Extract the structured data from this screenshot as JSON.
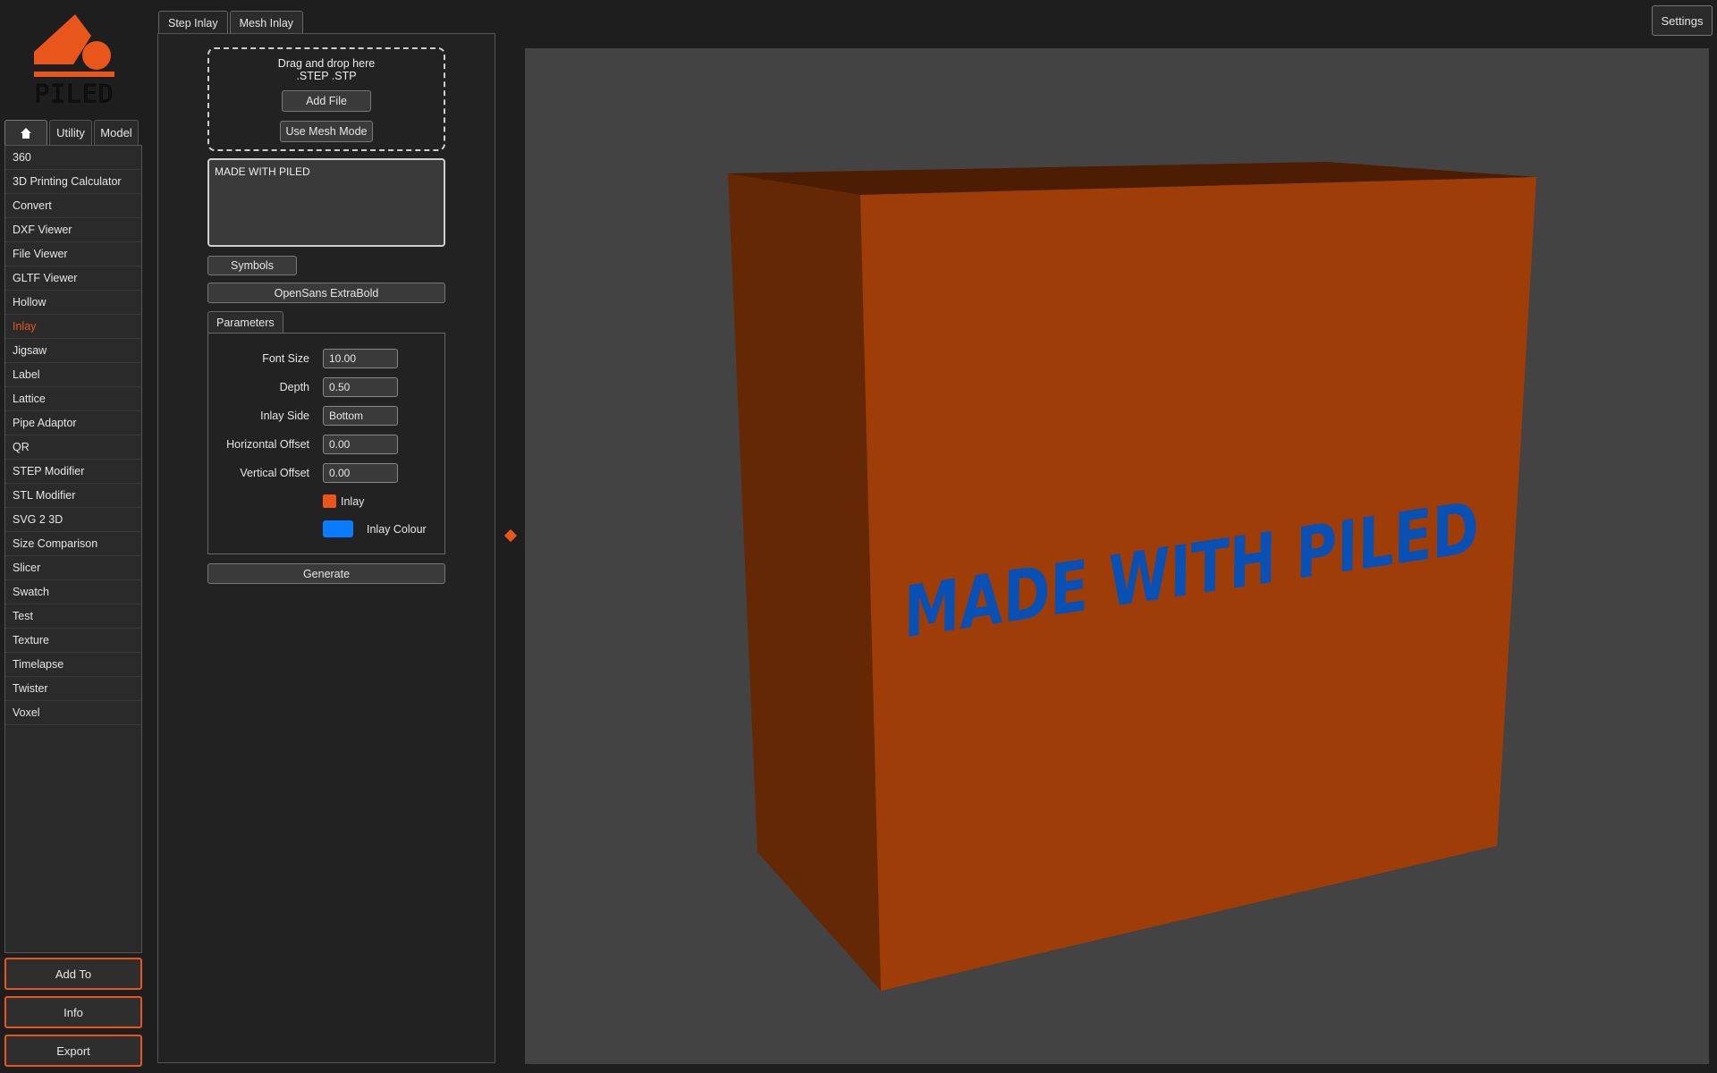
{
  "logo": {
    "text": "PILED"
  },
  "left_tabs": [
    {
      "label": "",
      "icon": "home-icon"
    },
    {
      "label": "Utility"
    },
    {
      "label": "Model"
    }
  ],
  "tools": [
    "360",
    "3D Printing Calculator",
    "Convert",
    "DXF Viewer",
    "File Viewer",
    "GLTF Viewer",
    "Hollow",
    "Inlay",
    "Jigsaw",
    "Label",
    "Lattice",
    "Pipe Adaptor",
    "QR",
    "STEP Modifier",
    "STL Modifier",
    "SVG 2 3D",
    "Size Comparison",
    "Slicer",
    "Swatch",
    "Test",
    "Texture",
    "Timelapse",
    "Twister",
    "Voxel"
  ],
  "active_tool": "Inlay",
  "left_buttons": {
    "add_to": "Add To",
    "info": "Info",
    "export": "Export"
  },
  "center_tabs": {
    "step_inlay": "Step Inlay",
    "mesh_inlay": "Mesh Inlay"
  },
  "dropzone": {
    "line1": "Drag and drop here",
    "line2": ".STEP .STP",
    "add_file": "Add File",
    "use_mesh_mode": "Use Mesh Mode"
  },
  "text_input": {
    "value": "MADE WITH PILED"
  },
  "symbols_button": "Symbols",
  "font_button": "OpenSans ExtraBold",
  "parameters": {
    "tab_label": "Parameters",
    "font_size": {
      "label": "Font Size",
      "value": "10.00"
    },
    "depth": {
      "label": "Depth",
      "value": "0.50"
    },
    "inlay_side": {
      "label": "Inlay Side",
      "value": "Bottom"
    },
    "horizontal_offset": {
      "label": "Horizontal Offset",
      "value": "0.00"
    },
    "vertical_offset": {
      "label": "Vertical Offset",
      "value": "0.00"
    },
    "inlay_label": "Inlay",
    "inlay_colour_label": "Inlay Colour"
  },
  "generate_button": "Generate",
  "settings_button": "Settings",
  "viewport": {
    "model_text": "MADE WITH PILED"
  },
  "colors": {
    "accent": "#e8561b",
    "inlay_swatch": "#e8561b",
    "inlay_colour_swatch": "#0a7cff",
    "box_front": "#9e3d07",
    "box_side": "#652805",
    "box_top": "#4c1d02",
    "text_blue": "#0950b5",
    "viewport_bg": "#434343"
  }
}
